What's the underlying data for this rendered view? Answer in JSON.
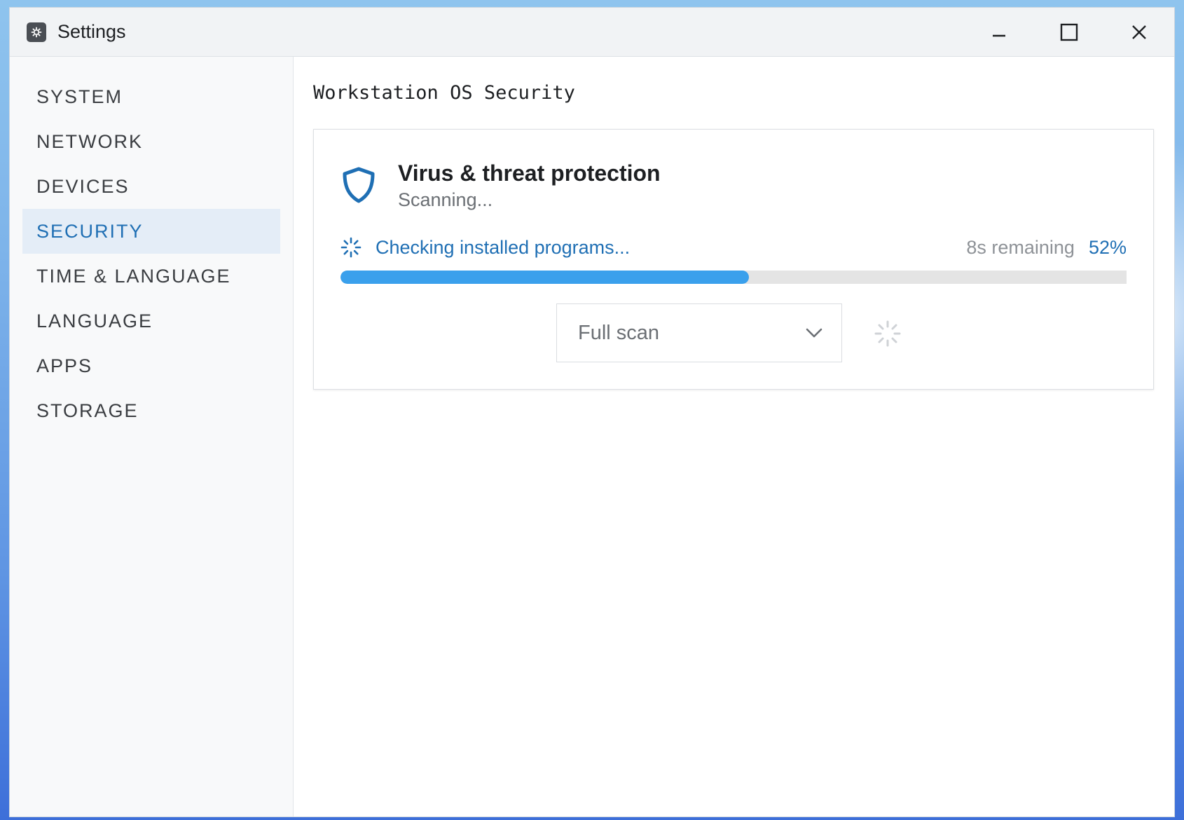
{
  "window": {
    "title": "Settings",
    "icons": {
      "app": "gear-icon",
      "minimize": "minimize-icon",
      "maximize": "maximize-icon",
      "close": "close-icon"
    }
  },
  "sidebar": {
    "items": [
      {
        "label": "SYSTEM",
        "active": false
      },
      {
        "label": "NETWORK",
        "active": false
      },
      {
        "label": "DEVICES",
        "active": false
      },
      {
        "label": "SECURITY",
        "active": true
      },
      {
        "label": "TIME & LANGUAGE",
        "active": false
      },
      {
        "label": "LANGUAGE",
        "active": false
      },
      {
        "label": "APPS",
        "active": false
      },
      {
        "label": "STORAGE",
        "active": false
      }
    ]
  },
  "main": {
    "page_title": "Workstation OS Security",
    "card": {
      "icon": "shield-icon",
      "title": "Virus & threat protection",
      "subtitle": "Scanning...",
      "progress_label": "Checking installed programs...",
      "remaining": "8s remaining",
      "percent_text": "52%",
      "progress_value": 0.52,
      "scan_select": {
        "value": "Full scan",
        "icon": "chevron-down-icon"
      },
      "loading_icon": "spinner-icon"
    }
  },
  "colors": {
    "accent": "#1f6fb4",
    "progress_fill": "#3aa0ec",
    "progress_track": "#e4e4e4",
    "active_nav_bg": "#e4edf7"
  }
}
